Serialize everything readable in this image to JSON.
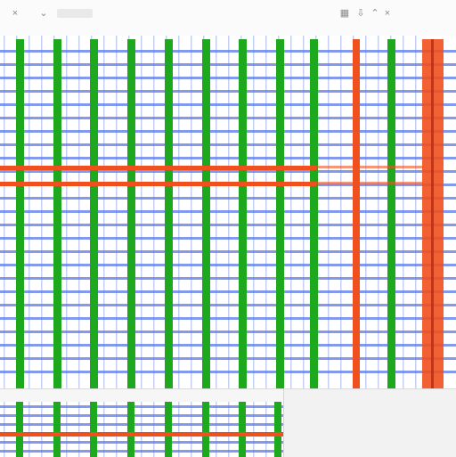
{
  "toolbar": {
    "icons": [
      {
        "name": "close-icon",
        "glyph": "×"
      },
      {
        "name": "collapse-icon",
        "glyph": "⌄"
      },
      {
        "name": "grid-toggle-icon",
        "glyph": "▦"
      },
      {
        "name": "export-icon",
        "glyph": "⇩"
      },
      {
        "name": "expand-icon",
        "glyph": "⌃"
      },
      {
        "name": "window-close-icon",
        "glyph": "×"
      }
    ]
  },
  "colors": {
    "background": "#ffffff",
    "minor_grid": "#5a78e6",
    "major_grid": "#1ea81e",
    "highlight": "#f0501e",
    "toolbar": "#fbfbfb"
  },
  "grid": {
    "minor_rows": 22,
    "major_columns": 11,
    "highlight_rows": 2,
    "highlight_columns": 2
  },
  "mini_grid": {
    "minor_rows": 4,
    "major_columns": 8,
    "highlight_rows": 1
  }
}
